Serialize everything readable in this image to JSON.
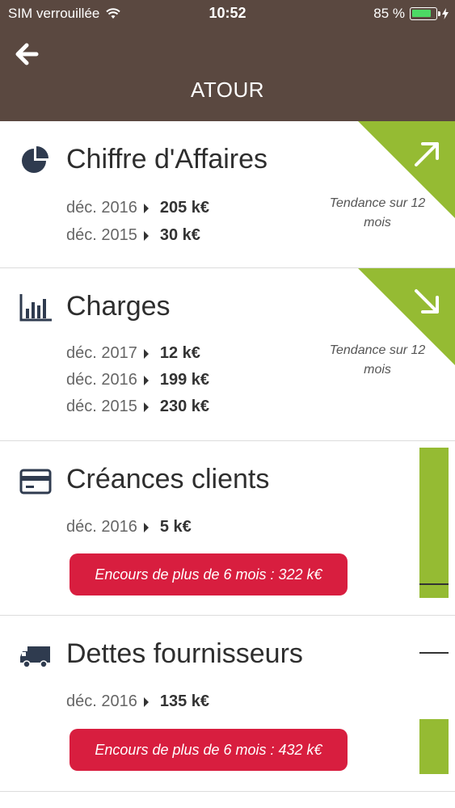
{
  "status_bar": {
    "carrier": "SIM verrouillée",
    "time": "10:52",
    "battery": "85 %",
    "battery_level": 0.85
  },
  "header": {
    "title": "ATOUR"
  },
  "cards": [
    {
      "title": "Chiffre d'Affaires",
      "icon": "pie-chart-icon",
      "rows": [
        {
          "label": "déc. 2016",
          "value": "205 k€"
        },
        {
          "label": "déc. 2015",
          "value": "30 k€"
        }
      ],
      "trend": {
        "direction": "up",
        "label": "Tendance sur 12 mois",
        "color": "#95bb33"
      }
    },
    {
      "title": "Charges",
      "icon": "bar-chart-icon",
      "rows": [
        {
          "label": "déc. 2017",
          "value": "12 k€"
        },
        {
          "label": "déc. 2016",
          "value": "199 k€"
        },
        {
          "label": "déc. 2015",
          "value": "230 k€"
        }
      ],
      "trend": {
        "direction": "down",
        "label": "Tendance sur 12 mois",
        "color": "#95bb33"
      }
    },
    {
      "title": "Créances clients",
      "icon": "credit-card-icon",
      "rows": [
        {
          "label": "déc. 2016",
          "value": "5 k€"
        }
      ],
      "alert": "Encours de plus de 6 mois : 322 k€"
    },
    {
      "title": "Dettes fournisseurs",
      "icon": "truck-icon",
      "rows": [
        {
          "label": "déc. 2016",
          "value": "135 k€"
        }
      ],
      "alert": "Encours de plus de 6 mois : 432 k€"
    }
  ],
  "colors": {
    "header_bg": "#5a4840",
    "accent_green": "#95bb33",
    "alert_red": "#d81e3f"
  }
}
